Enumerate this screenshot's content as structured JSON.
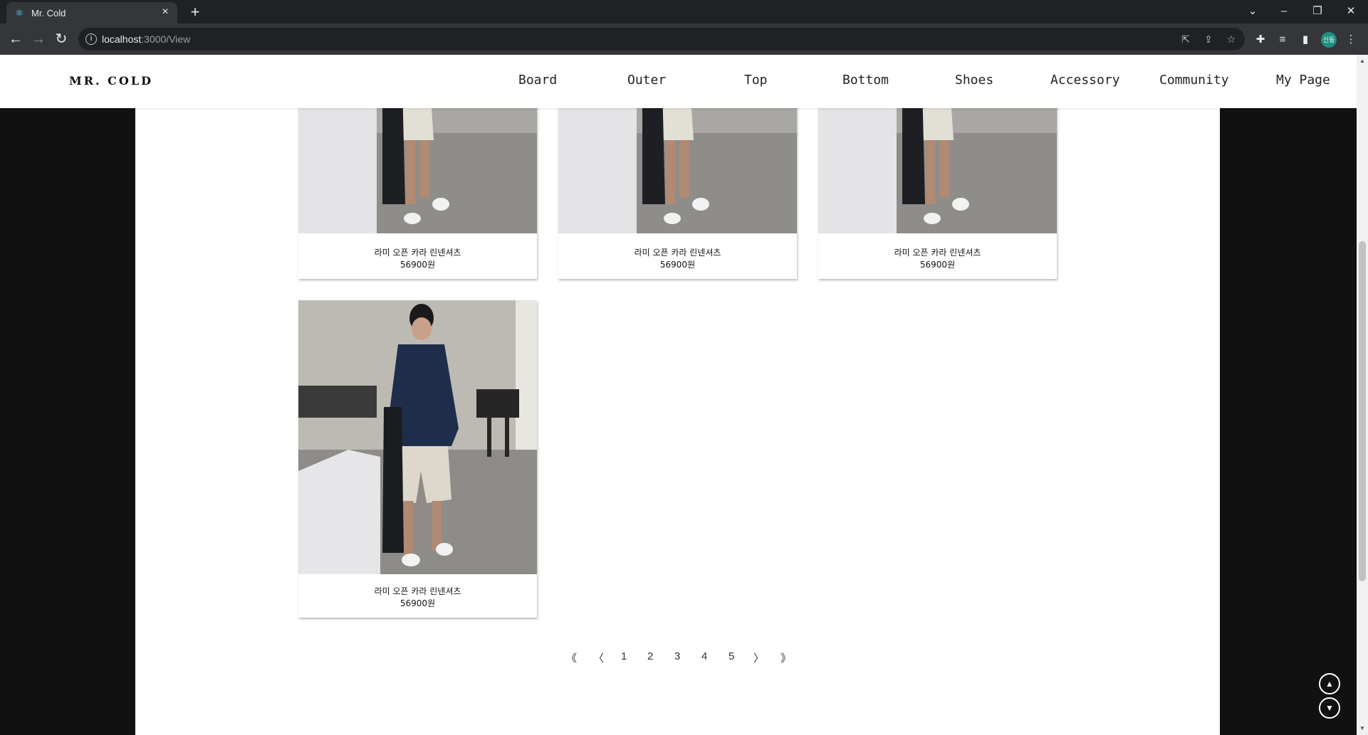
{
  "browser": {
    "tab_title": "Mr. Cold",
    "url_host": "localhost",
    "url_path": ":3000/View",
    "profile_label": "신동"
  },
  "site": {
    "logo": "MR. COLD",
    "menu": [
      "Board",
      "Outer",
      "Top",
      "Bottom",
      "Shoes",
      "Accessory",
      "Community",
      "My Page"
    ]
  },
  "products": [
    {
      "name": "라미 오픈 카라 린넨셔츠",
      "price": "56900원"
    },
    {
      "name": "라미 오픈 카라 린넨셔츠",
      "price": "56900원"
    },
    {
      "name": "라미 오픈 카라 린넨셔츠",
      "price": "56900원"
    },
    {
      "name": "라미 오픈 카라 린넨셔츠",
      "price": "56900원"
    }
  ],
  "pagination": {
    "first": "《",
    "prev": "〈",
    "pages": [
      "1",
      "2",
      "3",
      "4",
      "5"
    ],
    "next": "〉",
    "last": "》"
  },
  "scroll_buttons": {
    "up": "▲",
    "down": "▼"
  }
}
